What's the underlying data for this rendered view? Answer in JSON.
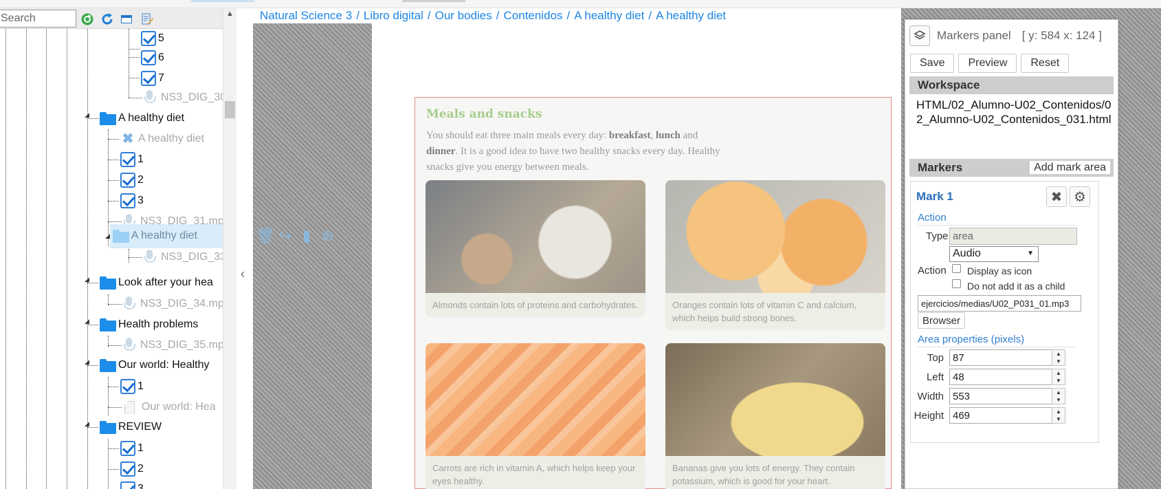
{
  "tree": {
    "search_placeholder": "Search",
    "toolbar_icons": [
      "refresh-green-icon",
      "refresh-blue-icon",
      "window-icon",
      "edit-document-icon"
    ],
    "rows": [
      {
        "label": "5",
        "type": "check"
      },
      {
        "label": "6",
        "type": "check"
      },
      {
        "label": "7",
        "type": "check"
      },
      {
        "label": "NS3_DIG_30",
        "type": "audio"
      },
      {
        "label": "A healthy diet",
        "type": "folder"
      },
      {
        "label": "A healthy diet",
        "type": "activity"
      },
      {
        "label": "1",
        "type": "check"
      },
      {
        "label": "2",
        "type": "check"
      },
      {
        "label": "3",
        "type": "check"
      },
      {
        "label": "NS3_DIG_31.mp",
        "type": "audio"
      },
      {
        "label": "A healthy diet",
        "type": "folder-selected"
      },
      {
        "label": "NS3_DIG_33",
        "type": "audio"
      },
      {
        "label": "Look after your hea",
        "type": "folder"
      },
      {
        "label": "NS3_DIG_34.mp",
        "type": "audio"
      },
      {
        "label": "Health problems",
        "type": "folder"
      },
      {
        "label": "NS3_DIG_35.mp",
        "type": "audio"
      },
      {
        "label": "Our world: Healthy",
        "type": "folder"
      },
      {
        "label": "1",
        "type": "check"
      },
      {
        "label": "Our world: Hea",
        "type": "page"
      },
      {
        "label": "REVIEW",
        "type": "folder"
      },
      {
        "label": "1",
        "type": "check"
      },
      {
        "label": "2",
        "type": "check"
      },
      {
        "label": "3",
        "type": "check"
      }
    ],
    "selected_tools": [
      "trash-icon",
      "share-icon",
      "page-icon",
      "download-icon"
    ]
  },
  "breadcrumb": [
    "Natural Science 3",
    "Libro digital",
    "Our bodies",
    "Contenidos",
    "A healthy diet",
    "A healthy diet"
  ],
  "content": {
    "heading": "Meals and snacks",
    "intro_1": "You should eat three main meals every day: ",
    "intro_b1": "breakfast",
    "intro_2": ", ",
    "intro_b2": "lunch",
    "intro_3": " and ",
    "intro_b3": "dinner",
    "intro_4": ". It is a good idea to have two healthy snacks every day. Healthy snacks give you energy between meals.",
    "cards": [
      {
        "caption": "Almonds contain lots of proteins and carbohydrates.",
        "image": "almonds"
      },
      {
        "caption": "Oranges contain lots of vitamin C and calcium, which helps build strong bones.",
        "image": "oranges"
      },
      {
        "caption": "Carrots are rich in vitamin A, which helps keep your eyes healthy.",
        "image": "carrots"
      },
      {
        "caption": "Bananas give you lots of energy. They contain potassium, which is good for your heart.",
        "image": "bananas"
      }
    ]
  },
  "panel": {
    "title": "Markers panel",
    "coords": "[ y: 584 x: 124 ]",
    "buttons": {
      "save": "Save",
      "preview": "Preview",
      "reset": "Reset"
    },
    "workspace_label": "Workspace",
    "workspace_path": "HTML/02_Alumno-U02_Contenidos/02_Alumno-U02_Contenidos_031.html",
    "markers_label": "Markers",
    "add_mark_area": "Add mark area",
    "mark": {
      "title": "Mark 1",
      "action_section": "Action",
      "type_label": "Type",
      "type_value": "area",
      "action_select": "Audio",
      "action_label": "Action",
      "display_as_icon": "Display as icon",
      "not_child": "Do not add it as a child",
      "file_value": "ejercicios/medias/U02_P031_01.mp3",
      "browser": "Browser",
      "area_section": "Area properties (pixels)",
      "top_label": "Top",
      "top_value": "87",
      "left_label": "Left",
      "left_value": "48",
      "width_label": "Width",
      "width_value": "553",
      "height_label": "Height",
      "height_value": "469"
    }
  }
}
